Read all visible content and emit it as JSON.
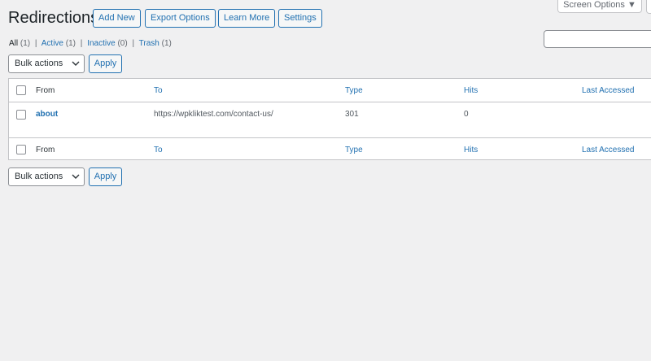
{
  "header": {
    "title": "Redirections",
    "buttons": [
      "Add New",
      "Export Options",
      "Learn More",
      "Settings"
    ],
    "screen_options_label": "Screen Options ▼"
  },
  "filters": {
    "all_label": "All",
    "all_count": "(1)",
    "active_label": "Active",
    "active_count": "(1)",
    "inactive_label": "Inactive",
    "inactive_count": "(0)",
    "trash_label": "Trash",
    "trash_count": "(1)",
    "separator": "|"
  },
  "bulk_top": {
    "selected": "Bulk actions",
    "apply_label": "Apply"
  },
  "bulk_bottom": {
    "selected": "Bulk actions",
    "apply_label": "Apply"
  },
  "table": {
    "columns": [
      "From",
      "To",
      "Type",
      "Hits",
      "Last Accessed"
    ],
    "rows": [
      {
        "from": "about",
        "to": "https://wpkliktest.com/contact-us/",
        "type": "301",
        "hits": "0",
        "last_accessed": ""
      }
    ]
  },
  "colors": {
    "accent": "#2271b1",
    "background": "#f0f0f1"
  }
}
